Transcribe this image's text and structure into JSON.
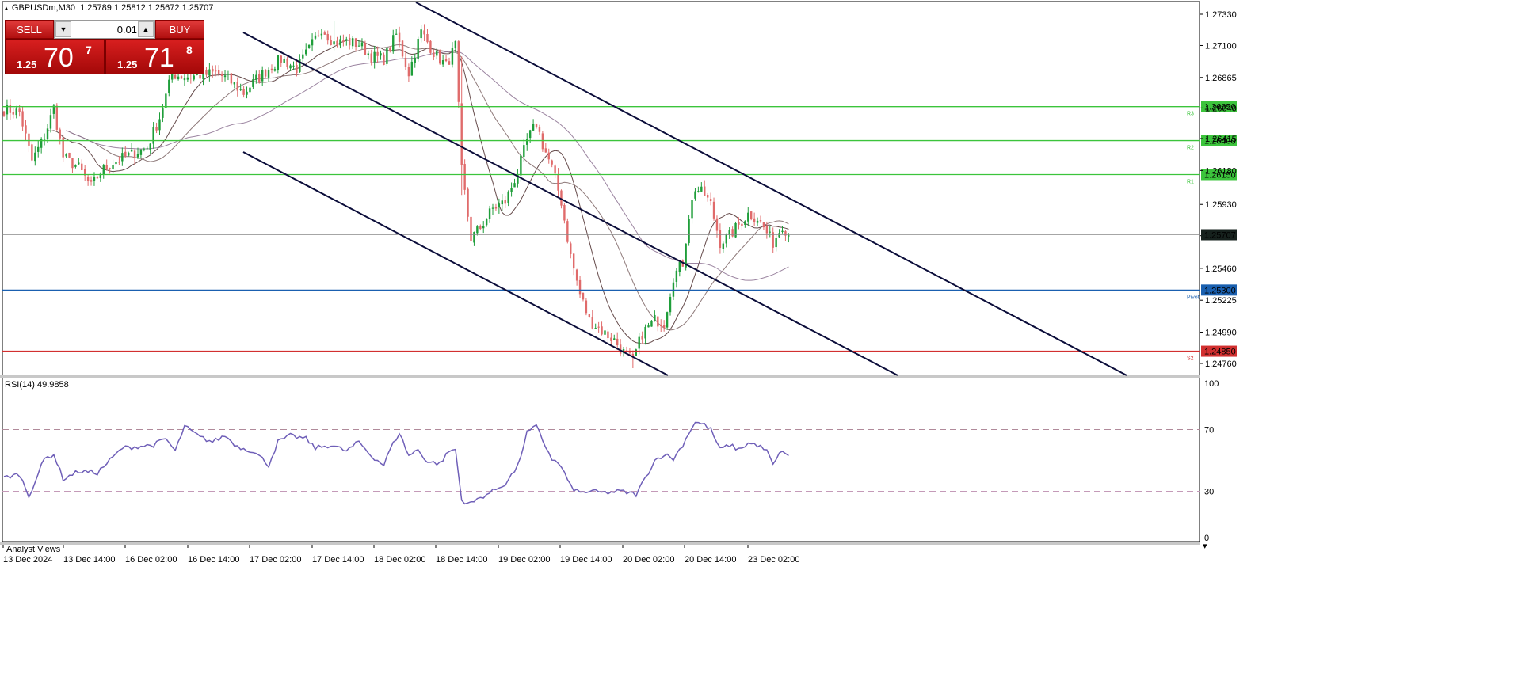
{
  "header": {
    "symbol_tf": "GBPUSDm,M30",
    "ohlc": "1.25789 1.25812 1.25672 1.25707"
  },
  "trade_panel": {
    "sell_label": "SELL",
    "buy_label": "BUY",
    "lot": "0.01",
    "sell_prefix": "1.25",
    "sell_big": "70",
    "sell_sup": "7",
    "buy_prefix": "1.25",
    "buy_big": "71",
    "buy_sup": "8"
  },
  "rsi_title": "RSI(14) 49.9858",
  "analyst_label": "Analyst Views",
  "colors": {
    "bull": "#1f9e3a",
    "bear": "#e06b6b",
    "channel": "#0b0d3a",
    "resistance": "#3cc43c",
    "pivot": "#1a60b0",
    "support": "#d23030",
    "current": "#888888",
    "rsi_line": "#6f5fb8",
    "ma_fast": "#4a2a2a",
    "ma_mid": "#7a6262",
    "ma_slow": "#8a6f8f"
  },
  "chart_data": [
    {
      "type": "candlestick",
      "symbol": "GBPUSDm",
      "timeframe": "M30",
      "ylim": [
        1.2465,
        1.2745
      ],
      "y_ticks": [
        "1.27330",
        "1.27100",
        "1.26865",
        "1.26640",
        "1.26415",
        "1.26180",
        "1.25930",
        "1.25700",
        "1.25460",
        "1.25225",
        "1.24990",
        "1.24760"
      ],
      "y_tick_values": [
        1.2733,
        1.271,
        1.26865,
        1.2664,
        1.26415,
        1.2618,
        1.2593,
        1.257,
        1.2546,
        1.25225,
        1.2499,
        1.2476
      ],
      "x_ticks": [
        "13 Dec 2024",
        "13 Dec 14:00",
        "16 Dec 02:00",
        "16 Dec 14:00",
        "17 Dec 02:00",
        "17 Dec 14:00",
        "18 Dec 02:00",
        "18 Dec 14:00",
        "19 Dec 02:00",
        "19 Dec 14:00",
        "20 Dec 02:00",
        "20 Dec 14:00",
        "23 Dec 02:00"
      ],
      "levels": [
        {
          "label": "1.26650",
          "value": 1.2665,
          "tag": "R3",
          "kind": "resistance"
        },
        {
          "label": "1.26400",
          "value": 1.264,
          "tag": "R2",
          "kind": "resistance"
        },
        {
          "label": "1.26150",
          "value": 1.2615,
          "tag": "R1",
          "kind": "resistance"
        },
        {
          "label": "1.25300",
          "value": 1.253,
          "tag": "Pivot",
          "kind": "pivot"
        },
        {
          "label": "1.24850",
          "value": 1.2485,
          "tag": "S2",
          "kind": "support"
        }
      ],
      "current_price": {
        "label": "1.25707",
        "value": 1.25707
      },
      "anchors": [
        [
          0,
          1.2663
        ],
        [
          5,
          1.2661
        ],
        [
          9,
          1.2625
        ],
        [
          13,
          1.2643
        ],
        [
          16,
          1.2664
        ],
        [
          19,
          1.2628
        ],
        [
          24,
          1.262
        ],
        [
          28,
          1.2606
        ],
        [
          31,
          1.2617
        ],
        [
          35,
          1.2624
        ],
        [
          40,
          1.2629
        ],
        [
          46,
          1.2635
        ],
        [
          50,
          1.2657
        ],
        [
          54,
          1.2689
        ],
        [
          58,
          1.2687
        ],
        [
          63,
          1.2688
        ],
        [
          68,
          1.269
        ],
        [
          72,
          1.2685
        ],
        [
          77,
          1.2675
        ],
        [
          81,
          1.2685
        ],
        [
          85,
          1.2693
        ],
        [
          89,
          1.27
        ],
        [
          94,
          1.2693
        ],
        [
          98,
          1.2707
        ],
        [
          102,
          1.2723
        ],
        [
          106,
          1.2712
        ],
        [
          110,
          1.2713
        ],
        [
          114,
          1.2711
        ],
        [
          118,
          1.2702
        ],
        [
          122,
          1.27
        ],
        [
          126,
          1.2718
        ],
        [
          130,
          1.269
        ],
        [
          134,
          1.272
        ],
        [
          138,
          1.2705
        ],
        [
          142,
          1.2695
        ],
        [
          145,
          1.271
        ],
        [
          147,
          1.2618
        ],
        [
          150,
          1.2568
        ],
        [
          153,
          1.2576
        ],
        [
          157,
          1.259
        ],
        [
          161,
          1.2595
        ],
        [
          165,
          1.2617
        ],
        [
          168,
          1.264
        ],
        [
          171,
          1.2653
        ],
        [
          173,
          1.2637
        ],
        [
          176,
          1.262
        ],
        [
          179,
          1.2595
        ],
        [
          182,
          1.2555
        ],
        [
          185,
          1.2527
        ],
        [
          188,
          1.2508
        ],
        [
          192,
          1.25
        ],
        [
          196,
          1.2493
        ],
        [
          199,
          1.2484
        ],
        [
          202,
          1.2478
        ],
        [
          205,
          1.2498
        ],
        [
          209,
          1.2508
        ],
        [
          212,
          1.2506
        ],
        [
          215,
          1.254
        ],
        [
          218,
          1.255
        ],
        [
          220,
          1.2585
        ],
        [
          222,
          1.2605
        ],
        [
          225,
          1.26
        ],
        [
          227,
          1.2593
        ],
        [
          230,
          1.2565
        ],
        [
          233,
          1.257
        ],
        [
          236,
          1.2578
        ],
        [
          239,
          1.2586
        ],
        [
          242,
          1.2583
        ],
        [
          245,
          1.2572
        ],
        [
          247,
          1.2565
        ],
        [
          250,
          1.2578
        ],
        [
          252,
          1.2571
        ]
      ],
      "n_candles": 253
    },
    {
      "type": "line",
      "name": "RSI(14)",
      "ylim": [
        0,
        100
      ],
      "y_ticks": [
        100,
        70,
        30,
        0
      ],
      "levels": [
        70,
        30
      ],
      "anchors": [
        [
          0,
          39
        ],
        [
          5,
          41
        ],
        [
          8,
          27
        ],
        [
          13,
          51
        ],
        [
          16,
          54
        ],
        [
          19,
          38
        ],
        [
          24,
          43
        ],
        [
          30,
          42
        ],
        [
          33,
          48
        ],
        [
          38,
          58
        ],
        [
          43,
          59
        ],
        [
          48,
          60
        ],
        [
          52,
          64
        ],
        [
          55,
          56
        ],
        [
          58,
          72
        ],
        [
          63,
          65
        ],
        [
          67,
          62
        ],
        [
          71,
          66
        ],
        [
          75,
          59
        ],
        [
          80,
          56
        ],
        [
          83,
          51
        ],
        [
          85,
          47
        ],
        [
          88,
          62
        ],
        [
          92,
          66
        ],
        [
          97,
          64
        ],
        [
          100,
          58
        ],
        [
          105,
          60
        ],
        [
          110,
          56
        ],
        [
          114,
          62
        ],
        [
          118,
          53
        ],
        [
          122,
          47
        ],
        [
          124,
          57
        ],
        [
          127,
          68
        ],
        [
          130,
          53
        ],
        [
          133,
          57
        ],
        [
          136,
          49
        ],
        [
          140,
          48
        ],
        [
          143,
          56
        ],
        [
          145,
          57
        ],
        [
          147,
          24
        ],
        [
          150,
          22
        ],
        [
          153,
          26
        ],
        [
          157,
          30
        ],
        [
          161,
          35
        ],
        [
          165,
          46
        ],
        [
          168,
          68
        ],
        [
          171,
          72
        ],
        [
          173,
          63
        ],
        [
          176,
          51
        ],
        [
          179,
          46
        ],
        [
          182,
          33
        ],
        [
          185,
          29
        ],
        [
          188,
          30
        ],
        [
          193,
          29
        ],
        [
          198,
          30
        ],
        [
          203,
          28
        ],
        [
          205,
          35
        ],
        [
          209,
          50
        ],
        [
          212,
          54
        ],
        [
          215,
          51
        ],
        [
          218,
          60
        ],
        [
          220,
          68
        ],
        [
          222,
          75
        ],
        [
          225,
          73
        ],
        [
          227,
          70
        ],
        [
          230,
          57
        ],
        [
          233,
          60
        ],
        [
          236,
          57
        ],
        [
          239,
          61
        ],
        [
          242,
          60
        ],
        [
          245,
          56
        ],
        [
          247,
          47
        ],
        [
          250,
          57
        ],
        [
          252,
          52
        ]
      ],
      "last_value": 49.9858
    }
  ]
}
